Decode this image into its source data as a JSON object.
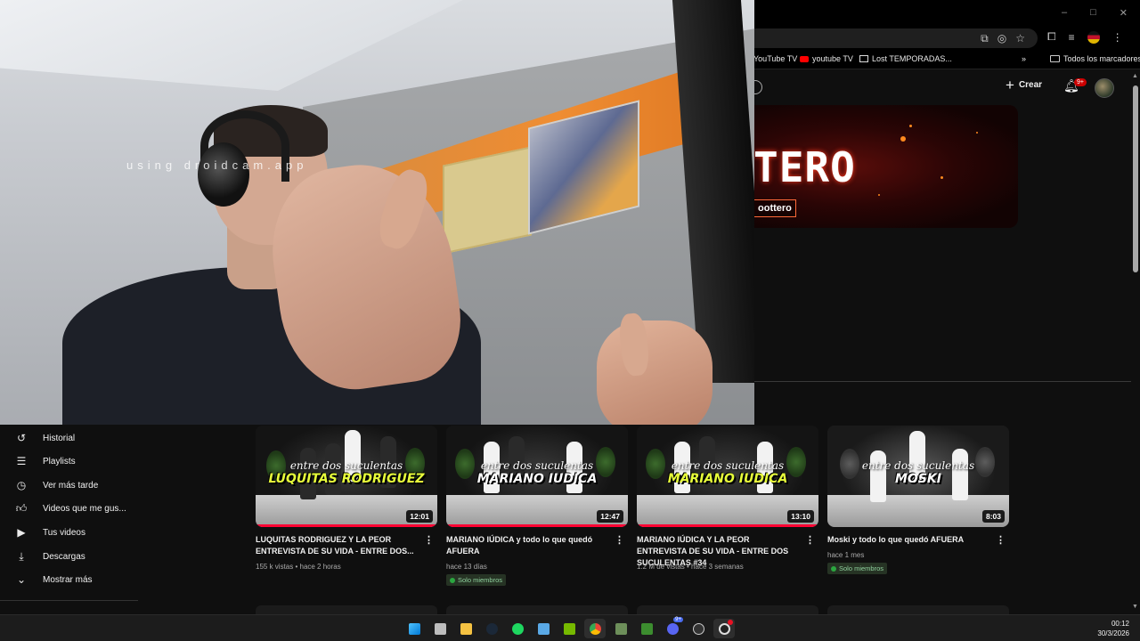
{
  "browser": {
    "win_controls": [
      "–",
      "□",
      "✕"
    ],
    "bookmarks": [
      {
        "label": "YouTube TV"
      },
      {
        "label": "youtube TV"
      },
      {
        "label": "Lost TEMPORADAS..."
      }
    ],
    "bookmarks_more": "»",
    "all_bookmarks_label": "Todos los marcadores"
  },
  "youtube_header": {
    "create_label": "Crear",
    "notification_count": "9+"
  },
  "banner": {
    "title_fragment": "TERO",
    "handle_fragment": "oottero"
  },
  "webcam": {
    "watermark": "using droidcam.app"
  },
  "sidebar": {
    "items": [
      {
        "label": "Historial",
        "icon": "history-icon"
      },
      {
        "label": "Playlists",
        "icon": "playlist-icon"
      },
      {
        "label": "Ver más tarde",
        "icon": "clock-icon"
      },
      {
        "label": "Videos que me gus...",
        "icon": "thumbs-up-icon"
      },
      {
        "label": "Tus videos",
        "icon": "video-icon"
      },
      {
        "label": "Descargas",
        "icon": "download-icon"
      },
      {
        "label": "Mostrar más",
        "icon": "chevron-down-icon"
      }
    ]
  },
  "videos": [
    {
      "title": "LUQUITAS RODRIGUEZ Y LA PEOR ENTREVISTA DE SU VIDA - ENTRE DOS...",
      "script_text": "entre dos suculentas",
      "thumb_name": "LUQUITAS RODRIGUEZ",
      "thumb_name_color": "#e8ff3a",
      "duration": "12:01",
      "meta": "155 k vistas • hace 2 horas",
      "members_label": "",
      "progress": 1.0
    },
    {
      "title": "MARIANO IÚDICA y todo lo que quedó AFUERA",
      "script_text": "entre dos suculentas",
      "thumb_name": "MARIANO IUDICA",
      "thumb_name_color": "#ffffff",
      "duration": "12:47",
      "meta": "hace 13 días",
      "members_label": "Solo miembros",
      "progress": 1.0
    },
    {
      "title": "MARIANO IÚDICA Y LA PEOR ENTREVISTA DE SU VIDA - ENTRE DOS SUCULENTAS #34",
      "script_text": "entre dos suculentas",
      "thumb_name": "MARIANO IUDICA",
      "thumb_name_color": "#e8ff3a",
      "duration": "13:10",
      "meta": "1.2 M de vistas • hace 3 semanas",
      "members_label": "",
      "progress": 1.0
    },
    {
      "title": "Moski y todo lo que quedó AFUERA",
      "script_text": "entre dos suculentas",
      "thumb_name": "MOSKI",
      "thumb_name_color": "#ffffff",
      "duration": "8:03",
      "meta": "hace 1 mes",
      "members_label": "Solo miembros",
      "progress": 0
    }
  ],
  "taskbar": {
    "discord_badge": "9+",
    "time": "00:12",
    "date": "30/3/2026"
  }
}
